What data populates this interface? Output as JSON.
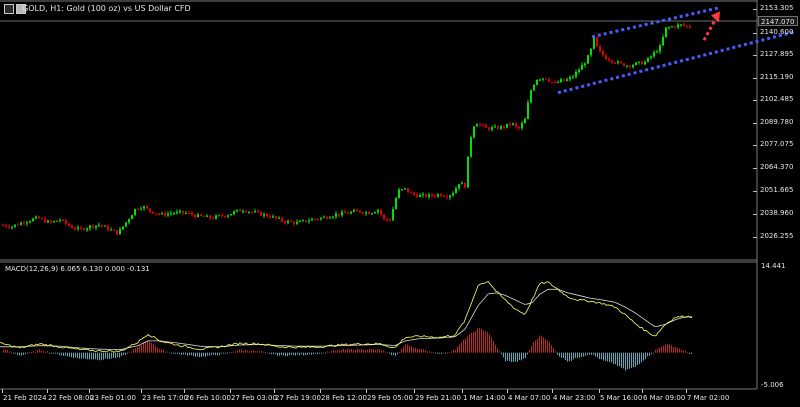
{
  "header": {
    "title": "GOLD, H1:  Gold (100 oz) vs US Dollar CFD"
  },
  "macd": {
    "label": "MACD(12,26,9) 6.065 6.130 0.000 -0.131",
    "scale_max": "14.441",
    "scale_min": "-5.006"
  },
  "price_axis": {
    "current_price": "2147.070",
    "labels": [
      "2153.305",
      "2140.600",
      "2127.895",
      "2115.190",
      "2102.485",
      "2089.780",
      "2077.075",
      "2064.370",
      "2051.665",
      "2038.960",
      "2026.255"
    ]
  },
  "time_axis": {
    "labels": [
      "21 Feb 2024",
      "22 Feb 08:00",
      "23 Feb 01:00",
      "23 Feb 17:00",
      "26 Feb 10:00",
      "27 Feb 03:00",
      "27 Feb 19:00",
      "28 Feb 12:00",
      "29 Feb 05:00",
      "29 Feb 21:00",
      "1 Mar 14:00",
      "4 Mar 07:00",
      "4 Mar 23:00",
      "5 Mar 16:00",
      "6 Mar 09:00",
      "7 Mar 02:00"
    ]
  },
  "colors": {
    "bull": "#00e100",
    "bear": "#e00000",
    "macd_line": "#ffff66",
    "signal_line": "#d8d8d8",
    "channel": "#4a5cff",
    "arrow": "#ff3b3b",
    "hist_pos": "#c8202a",
    "hist_neg": "#3fb6c8"
  },
  "chart_data": [
    {
      "type": "candlestick",
      "title": "GOLD, H1:  Gold (100 oz) vs US Dollar CFD",
      "x_start": "21 Feb 2024",
      "x_end": "7 Mar 02:00",
      "ylim": [
        2018,
        2158
      ],
      "current_price": 2147.07,
      "trend_path": [
        [
          0,
          2030
        ],
        [
          12,
          2029
        ],
        [
          25,
          2032
        ],
        [
          38,
          2034
        ],
        [
          50,
          2031
        ],
        [
          60,
          2033
        ],
        [
          70,
          2029
        ],
        [
          80,
          2027
        ],
        [
          90,
          2029
        ],
        [
          100,
          2030
        ],
        [
          110,
          2027
        ],
        [
          118,
          2025
        ],
        [
          128,
          2033
        ],
        [
          135,
          2039
        ],
        [
          142,
          2041
        ],
        [
          150,
          2038
        ],
        [
          162,
          2036
        ],
        [
          172,
          2037
        ],
        [
          185,
          2037
        ],
        [
          198,
          2035
        ],
        [
          212,
          2034
        ],
        [
          228,
          2036
        ],
        [
          242,
          2039
        ],
        [
          256,
          2037
        ],
        [
          270,
          2035
        ],
        [
          284,
          2032
        ],
        [
          298,
          2031
        ],
        [
          310,
          2033
        ],
        [
          322,
          2034
        ],
        [
          335,
          2036
        ],
        [
          348,
          2037
        ],
        [
          358,
          2038
        ],
        [
          370,
          2037
        ],
        [
          378,
          2039
        ],
        [
          384,
          2033
        ],
        [
          390,
          2033
        ],
        [
          398,
          2050
        ],
        [
          405,
          2051
        ],
        [
          412,
          2048
        ],
        [
          420,
          2047
        ],
        [
          430,
          2047
        ],
        [
          440,
          2048
        ],
        [
          448,
          2047
        ],
        [
          455,
          2050
        ],
        [
          458,
          2055
        ],
        [
          465,
          2053
        ],
        [
          470,
          2080
        ],
        [
          475,
          2091
        ],
        [
          485,
          2087
        ],
        [
          495,
          2087
        ],
        [
          505,
          2088
        ],
        [
          512,
          2090
        ],
        [
          518,
          2086
        ],
        [
          525,
          2092
        ],
        [
          530,
          2108
        ],
        [
          536,
          2116
        ],
        [
          545,
          2117
        ],
        [
          555,
          2113
        ],
        [
          560,
          2115
        ],
        [
          565,
          2115
        ],
        [
          572,
          2117
        ],
        [
          578,
          2121
        ],
        [
          585,
          2126
        ],
        [
          590,
          2131
        ],
        [
          594,
          2140
        ],
        [
          598,
          2133
        ],
        [
          605,
          2129
        ],
        [
          612,
          2127
        ],
        [
          620,
          2125
        ],
        [
          628,
          2124
        ],
        [
          636,
          2125
        ],
        [
          645,
          2126
        ],
        [
          652,
          2130
        ],
        [
          660,
          2135
        ],
        [
          666,
          2146
        ],
        [
          672,
          2147
        ],
        [
          680,
          2148
        ],
        [
          688,
          2147
        ],
        [
          692,
          2147
        ]
      ],
      "trend_channel": {
        "upper": [
          [
            592,
            2141
          ],
          [
            718,
            2158
          ]
        ],
        "lower": [
          [
            558,
            2108
          ],
          [
            795,
            2144
          ]
        ]
      },
      "projection_arrow": {
        "from": [
          704,
          2139
        ],
        "to": [
          720,
          2156
        ]
      }
    },
    {
      "type": "macd",
      "name": "MACD(12,26,9)",
      "ylim": [
        -5.006,
        14.441
      ],
      "values": {
        "macd": 6.065,
        "signal": 6.13
      },
      "histogram_shape": [
        [
          0,
          0.8
        ],
        [
          20,
          -0.5
        ],
        [
          40,
          0.5
        ],
        [
          60,
          -0.4
        ],
        [
          80,
          -1.0
        ],
        [
          100,
          -1.2
        ],
        [
          120,
          -0.8
        ],
        [
          138,
          1.0
        ],
        [
          148,
          2.2
        ],
        [
          160,
          0.5
        ],
        [
          180,
          -0.3
        ],
        [
          200,
          -0.7
        ],
        [
          220,
          -0.3
        ],
        [
          240,
          0.5
        ],
        [
          260,
          0.2
        ],
        [
          280,
          -0.5
        ],
        [
          300,
          -0.4
        ],
        [
          320,
          -0.1
        ],
        [
          340,
          0.5
        ],
        [
          360,
          0.6
        ],
        [
          380,
          0.5
        ],
        [
          395,
          -0.6
        ],
        [
          405,
          1.4
        ],
        [
          420,
          0.6
        ],
        [
          440,
          -0.2
        ],
        [
          455,
          0.5
        ],
        [
          465,
          2.5
        ],
        [
          478,
          4.2
        ],
        [
          488,
          3.5
        ],
        [
          496,
          1.0
        ],
        [
          505,
          -1.4
        ],
        [
          515,
          -1.6
        ],
        [
          525,
          -1.0
        ],
        [
          532,
          1.5
        ],
        [
          540,
          3.0
        ],
        [
          548,
          2.0
        ],
        [
          558,
          -0.5
        ],
        [
          568,
          -1.5
        ],
        [
          578,
          -0.8
        ],
        [
          590,
          -0.2
        ],
        [
          602,
          -1.3
        ],
        [
          615,
          -2.0
        ],
        [
          625,
          -3.0
        ],
        [
          635,
          -2.4
        ],
        [
          645,
          -1.0
        ],
        [
          655,
          0.4
        ],
        [
          665,
          1.5
        ],
        [
          675,
          1.0
        ],
        [
          685,
          0.2
        ],
        [
          692,
          -0.3
        ]
      ],
      "macd_line_shape": [
        [
          0,
          1.6
        ],
        [
          20,
          0.8
        ],
        [
          40,
          1.5
        ],
        [
          60,
          1.0
        ],
        [
          80,
          0.5
        ],
        [
          100,
          0.3
        ],
        [
          120,
          0.2
        ],
        [
          138,
          1.8
        ],
        [
          148,
          3.2
        ],
        [
          160,
          2.0
        ],
        [
          180,
          1.2
        ],
        [
          200,
          0.6
        ],
        [
          220,
          1.0
        ],
        [
          240,
          1.6
        ],
        [
          260,
          1.5
        ],
        [
          280,
          1.0
        ],
        [
          300,
          0.9
        ],
        [
          320,
          1.0
        ],
        [
          340,
          1.3
        ],
        [
          360,
          1.5
        ],
        [
          380,
          1.5
        ],
        [
          395,
          0.8
        ],
        [
          405,
          2.6
        ],
        [
          420,
          2.8
        ],
        [
          440,
          2.6
        ],
        [
          455,
          3.0
        ],
        [
          465,
          5.5
        ],
        [
          478,
          11.5
        ],
        [
          488,
          12.2
        ],
        [
          496,
          10.5
        ],
        [
          505,
          9.0
        ],
        [
          515,
          7.5
        ],
        [
          525,
          6.5
        ],
        [
          532,
          9.0
        ],
        [
          540,
          11.8
        ],
        [
          548,
          12.0
        ],
        [
          558,
          10.8
        ],
        [
          568,
          9.5
        ],
        [
          578,
          9.0
        ],
        [
          590,
          8.8
        ],
        [
          602,
          8.4
        ],
        [
          615,
          7.8
        ],
        [
          625,
          6.5
        ],
        [
          635,
          5.0
        ],
        [
          645,
          3.8
        ],
        [
          655,
          2.8
        ],
        [
          665,
          4.8
        ],
        [
          675,
          6.0
        ],
        [
          685,
          6.2
        ],
        [
          692,
          6.1
        ]
      ],
      "signal_line_shape": [
        [
          0,
          1.0
        ],
        [
          20,
          1.0
        ],
        [
          40,
          1.2
        ],
        [
          60,
          1.1
        ],
        [
          80,
          0.8
        ],
        [
          100,
          0.6
        ],
        [
          120,
          0.5
        ],
        [
          138,
          1.2
        ],
        [
          148,
          2.0
        ],
        [
          160,
          2.0
        ],
        [
          180,
          1.6
        ],
        [
          200,
          1.1
        ],
        [
          220,
          1.0
        ],
        [
          240,
          1.3
        ],
        [
          260,
          1.4
        ],
        [
          280,
          1.2
        ],
        [
          300,
          1.1
        ],
        [
          320,
          1.1
        ],
        [
          340,
          1.2
        ],
        [
          360,
          1.3
        ],
        [
          380,
          1.4
        ],
        [
          395,
          1.2
        ],
        [
          405,
          2.0
        ],
        [
          420,
          2.4
        ],
        [
          440,
          2.5
        ],
        [
          455,
          2.7
        ],
        [
          465,
          4.0
        ],
        [
          478,
          8.0
        ],
        [
          488,
          10.0
        ],
        [
          496,
          10.2
        ],
        [
          505,
          9.8
        ],
        [
          515,
          9.0
        ],
        [
          525,
          8.2
        ],
        [
          532,
          8.5
        ],
        [
          540,
          10.0
        ],
        [
          548,
          10.8
        ],
        [
          558,
          10.8
        ],
        [
          568,
          10.2
        ],
        [
          578,
          9.8
        ],
        [
          590,
          9.3
        ],
        [
          602,
          9.0
        ],
        [
          615,
          8.6
        ],
        [
          625,
          7.8
        ],
        [
          635,
          6.8
        ],
        [
          645,
          5.6
        ],
        [
          655,
          4.4
        ],
        [
          665,
          4.8
        ],
        [
          675,
          5.6
        ],
        [
          685,
          6.1
        ],
        [
          692,
          6.13
        ]
      ]
    }
  ]
}
